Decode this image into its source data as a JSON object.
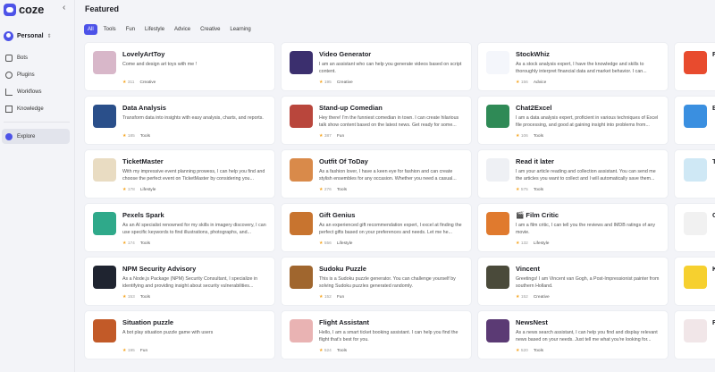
{
  "app": {
    "name": "coze"
  },
  "sidebar": {
    "workspace": "Personal",
    "items": [
      {
        "label": "Bots"
      },
      {
        "label": "Plugins"
      },
      {
        "label": "Workflows"
      },
      {
        "label": "Knowledge"
      },
      {
        "label": "Explore",
        "active": true
      }
    ]
  },
  "main": {
    "title": "Featured",
    "tabs": [
      "All",
      "Tools",
      "Fun",
      "Lifestyle",
      "Advice",
      "Creative",
      "Learning"
    ],
    "cards": [
      {
        "title": "LovelyArtToy",
        "desc": "Come and design art toys with me !",
        "count": "311",
        "category": "Creative",
        "thumb": "#d8b7c9"
      },
      {
        "title": "Video Generator",
        "desc": "I am an assistant who can help you generate videos based on script content.",
        "count": "195",
        "category": "Creative",
        "thumb": "#3b2f6e"
      },
      {
        "title": "StockWhiz",
        "desc": "As a stock analysis expert, I have the knowledge and skills to thoroughly interpret financial data and market behavior. I can...",
        "count": "156",
        "category": "Advice",
        "thumb": "#f4f6fb"
      },
      {
        "title": "Data Analysis",
        "desc": "Transform data into insights with easy analysis, charts, and reports.",
        "count": "185",
        "category": "Tools",
        "thumb": "#2a4f8a"
      },
      {
        "title": "Stand-up Comedian",
        "desc": "Hey there! I'm the funniest comedian in town. I can create hilarious talk show content based on the latest news. Get ready for some...",
        "count": "387",
        "category": "Fun",
        "thumb": "#b9463c"
      },
      {
        "title": "Chat2Excel",
        "desc": "I am a data analysis expert, proficient in various techniques of Excel file processing, and good at gaining insight into problems from...",
        "count": "106",
        "category": "Tools",
        "thumb": "#2f8a56"
      },
      {
        "title": "TicketMaster",
        "desc": "With my impressive event planning prowess, I can help you find and choose the perfect event on TicketMaster by considering you...",
        "count": "178",
        "category": "Lifestyle",
        "thumb": "#e9dcc2"
      },
      {
        "title": "Outfit Of ToDay",
        "desc": "As a fashion lover, I have a keen eye for fashion and can create stylish ensembles for any occasion. Whether you need a casual...",
        "count": "276",
        "category": "Tools",
        "thumb": "#d98a4a"
      },
      {
        "title": "Read it later",
        "desc": "I am your article reading and collection assistant. You can send me the articles you want to collect and I will automatically save them...",
        "count": "575",
        "category": "Tools",
        "thumb": "#eef0f4"
      },
      {
        "title": "Pexels Spark",
        "desc": "As an AI specialist renowned for my skills in imagery discovery, I can use specific keywords to find illustrations, photographs, and...",
        "count": "174",
        "category": "Tools",
        "thumb": "#2fa98a"
      },
      {
        "title": "Gift Genius",
        "desc": "As an experienced gift recommendation expert, I excel at finding the perfect gifts based on your preferences and needs. Let me he...",
        "count": "556",
        "category": "Lifestyle",
        "thumb": "#c8742f"
      },
      {
        "title": "🎬 Film Critic",
        "desc": "I am a film critic, I can tell you the reviews and IMDB ratings of any movie.",
        "count": "132",
        "category": "Lifestyle",
        "thumb": "#e07a2e"
      },
      {
        "title": "NPM Security Advisory",
        "desc": "As a Node.js Package (NPM) Security Consultant, I specialize in identifying and providing insight about security vulnerabilities...",
        "count": "153",
        "category": "Tools",
        "thumb": "#1f2430"
      },
      {
        "title": "Sudoku Puzzle",
        "desc": "This is a Sudoku puzzle generator. You can challenge yourself by solving Sudoku puzzles generated randomly.",
        "count": "152",
        "category": "Fun",
        "thumb": "#a0662e"
      },
      {
        "title": "Vincent",
        "desc": "Greetings! I am Vincent van Gogh, a Post-Impressionist painter from southern Holland.",
        "count": "152",
        "category": "Creative",
        "thumb": "#4a4a3a"
      },
      {
        "title": "Situation puzzle",
        "desc": "A bot play situation puzzle game with users",
        "count": "195",
        "category": "Fun",
        "thumb": "#c25a28"
      },
      {
        "title": "Flight Assistant",
        "desc": "Hello, I am a smart ticket booking assistant. I can help you find the flight that's best for you.",
        "count": "524",
        "category": "Tools",
        "thumb": "#e9b3b3"
      },
      {
        "title": "NewsNest",
        "desc": "As a news search assistant, I can help you find and display relevant news based on your needs. Just tell me what you're looking for...",
        "count": "520",
        "category": "Tools",
        "thumb": "#5b3a74"
      }
    ],
    "partial_cards": [
      {
        "title": "R",
        "thumb": "#e84b2e"
      },
      {
        "title": "B",
        "thumb": "#3a8fe0"
      },
      {
        "title": "T",
        "thumb": "#cfe8f5"
      },
      {
        "title": "C",
        "thumb": "#f1f1f1"
      },
      {
        "title": "K",
        "thumb": "#f6d02f"
      },
      {
        "title": "R",
        "thumb": "#f1e6e8"
      }
    ]
  }
}
